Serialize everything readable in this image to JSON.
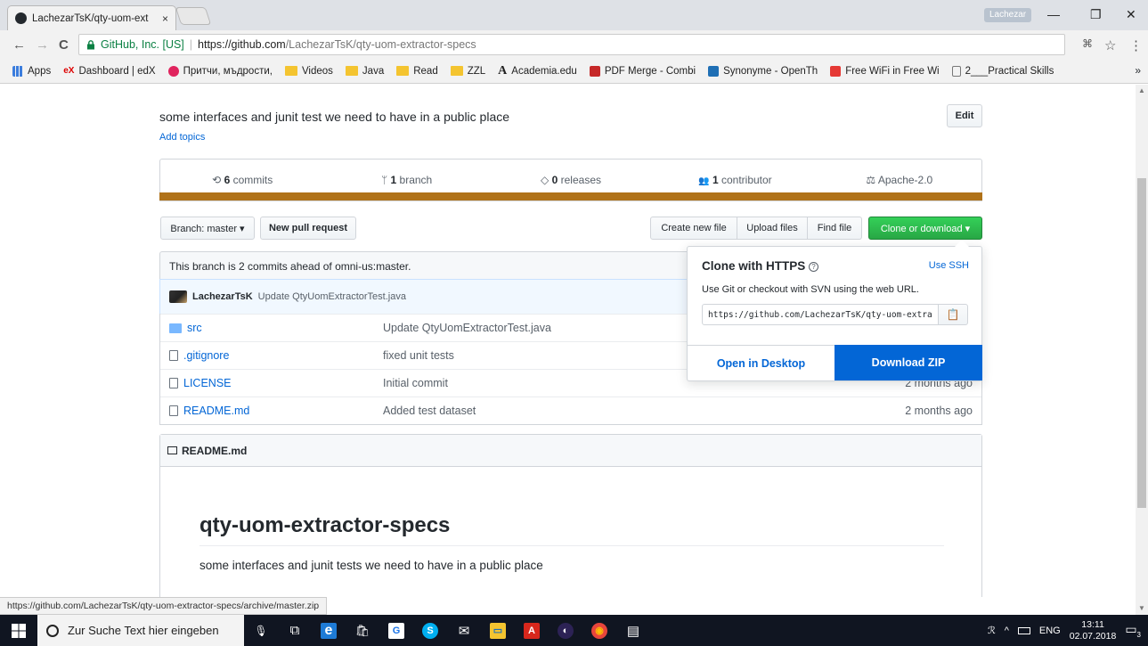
{
  "browser": {
    "tab_title": "LachezarTsK/qty-uom-ext",
    "tab_close": "×",
    "user_badge": "Lachezar",
    "minimize": "—",
    "restore": "❐",
    "close": "✕",
    "back": "←",
    "forward": "→",
    "reload": "C",
    "secure_label": "GitHub, Inc. [US]",
    "url_host": "https://github.com",
    "url_path": "/LachezarTsK/qty-uom-extractor-specs",
    "translate": "⌘",
    "star": "☆",
    "menu": "⋮",
    "bookmarks_more": "»",
    "bookmarks": [
      {
        "label": "Apps",
        "icon": "apps-grid-icon"
      },
      {
        "label": "Dashboard | edX",
        "icon": "edx-icon"
      },
      {
        "label": "Притчи, мъдрости, ",
        "icon": "flower-icon"
      },
      {
        "label": "Videos",
        "icon": "folder-icon"
      },
      {
        "label": "Java",
        "icon": "folder-icon"
      },
      {
        "label": "Read",
        "icon": "folder-icon"
      },
      {
        "label": "ZZL",
        "icon": "folder-icon"
      },
      {
        "label": "Academia.edu",
        "icon": "academia-icon"
      },
      {
        "label": "PDF Merge - Combi",
        "icon": "pdf-icon"
      },
      {
        "label": "Synonyme - OpenTh",
        "icon": "ot-icon"
      },
      {
        "label": "Free WiFi in Free Wi",
        "icon": "wifi-icon"
      },
      {
        "label": "2___Practical Skills",
        "icon": "page-icon"
      }
    ],
    "status_url": "https://github.com/LachezarTsK/qty-uom-extractor-specs/archive/master.zip"
  },
  "repo": {
    "description": "some interfaces and junit test we need to have in a public place",
    "add_topics": "Add topics",
    "edit": "Edit",
    "stats": [
      {
        "count": "6",
        "label": " commits",
        "icon": "history-icon",
        "glyph": "⟲"
      },
      {
        "count": "1",
        "label": " branch",
        "icon": "branch-icon",
        "glyph": "ᛘ"
      },
      {
        "count": "0",
        "label": " releases",
        "icon": "tag-icon",
        "glyph": "◇"
      },
      {
        "count": "1",
        "label": " contributor",
        "icon": "people-icon",
        "glyph": "👥"
      },
      {
        "count": "",
        "label": "Apache-2.0",
        "icon": "law-icon",
        "glyph": "⚖"
      }
    ],
    "lang_color": "#b07219",
    "branch_label": "Branch: master ▾",
    "new_pr": "New pull request",
    "create_file": "Create new file",
    "upload_files": "Upload files",
    "find_file": "Find file",
    "clone_download": "Clone or download ▾",
    "tracking": "This branch is 2 commits ahead of omni-us:master.",
    "tease_author": "LachezarTsK",
    "tease_message": "Update QtyUomExtractorTest.java",
    "files": [
      {
        "name": "src",
        "type": "dir",
        "message": "Update QtyUomExtractorTest.java",
        "age": ""
      },
      {
        "name": ".gitignore",
        "type": "file",
        "message": "fixed unit tests",
        "age": ""
      },
      {
        "name": "LICENSE",
        "type": "file",
        "message": "Initial commit",
        "age": "2 months ago"
      },
      {
        "name": "README.md",
        "type": "file",
        "message": "Added test dataset",
        "age": "2 months ago"
      }
    ],
    "readme_file": "README.md",
    "readme_title": "qty-uom-extractor-specs",
    "readme_body": "some interfaces and junit tests we need to have in a public place"
  },
  "clone": {
    "title": "Clone with HTTPS",
    "help": "?",
    "use_ssh": "Use SSH",
    "instructions": "Use Git or checkout with SVN using the web URL.",
    "url": "https://github.com/LachezarTsK/qty-uom-extractor-specs.git",
    "copy": "📋",
    "open_desktop": "Open in Desktop",
    "download_zip": "Download ZIP"
  },
  "taskbar": {
    "search_placeholder": "Zur Suche Text hier eingeben",
    "apps": [
      {
        "icon": "microphone-icon",
        "glyph": "🎙",
        "bg": ""
      },
      {
        "icon": "task-view-icon",
        "glyph": "⧉",
        "bg": ""
      },
      {
        "icon": "edge-icon",
        "glyph": "e",
        "bg": "#1e7bd6"
      },
      {
        "icon": "store-icon",
        "glyph": "🛍",
        "bg": ""
      },
      {
        "icon": "g-app-icon",
        "glyph": "G",
        "bg": "#1a73e8"
      },
      {
        "icon": "skype-icon",
        "glyph": "S",
        "bg": "#00aff0"
      },
      {
        "icon": "mail-icon",
        "glyph": "✉",
        "bg": ""
      },
      {
        "icon": "file-explorer-icon",
        "glyph": "▭",
        "bg": "#f4c430"
      },
      {
        "icon": "acrobat-icon",
        "glyph": "A",
        "bg": "#d8271c"
      },
      {
        "icon": "eclipse-icon",
        "glyph": "◐",
        "bg": "#2c2255"
      },
      {
        "icon": "chrome-icon",
        "glyph": "◉",
        "bg": "#e8453c"
      },
      {
        "icon": "app-icon",
        "glyph": "▤",
        "bg": ""
      }
    ],
    "lang": "ENG",
    "time": "13:11",
    "date": "02.07.2018",
    "notifications": "3"
  }
}
